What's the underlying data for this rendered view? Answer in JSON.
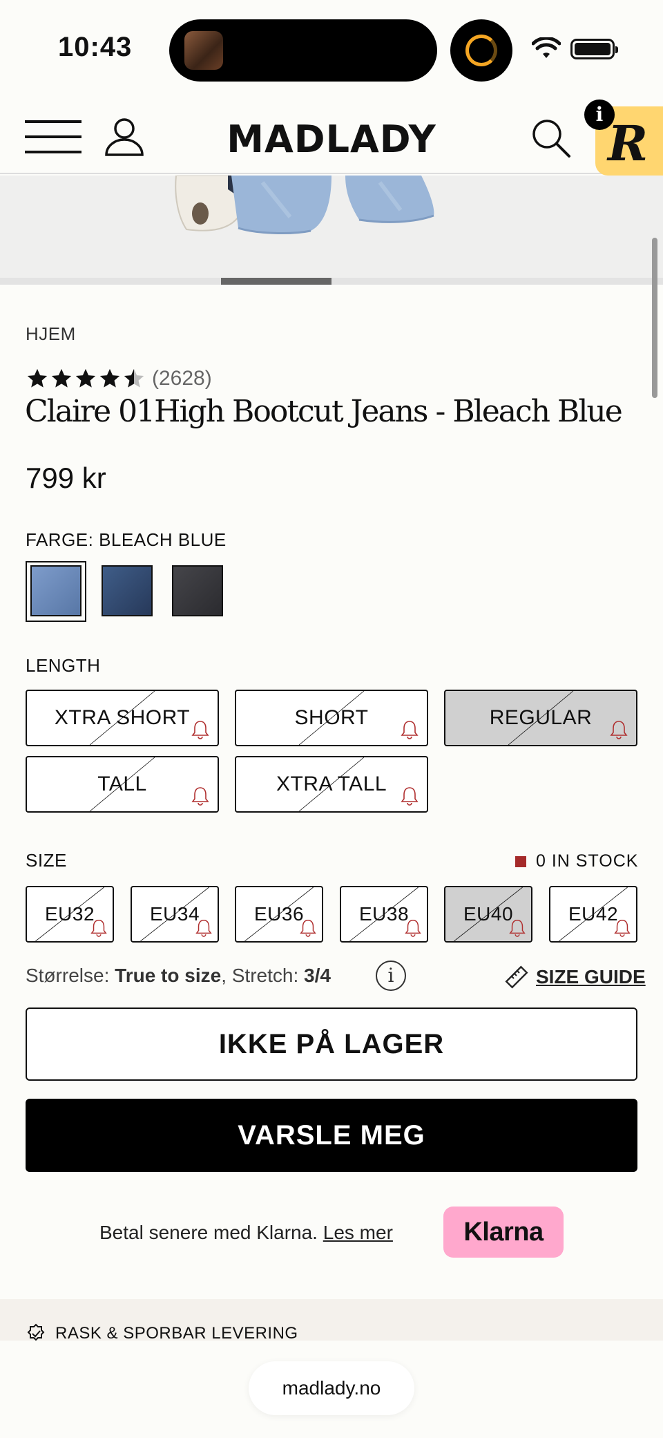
{
  "status_bar": {
    "time": "10:43"
  },
  "header": {
    "logo": "MADLADY"
  },
  "breadcrumb": "HJEM",
  "product": {
    "rating": 4.5,
    "rating_count": "(2628)",
    "title": "Claire 01High Bootcut Jeans - Bleach Blue",
    "price": "799 kr"
  },
  "color": {
    "label": "FARGE: BLEACH BLUE",
    "swatches": [
      {
        "name": "Bleach Blue",
        "color": "#6a8bb8",
        "selected": true
      },
      {
        "name": "Dark Blue",
        "color": "#34507a",
        "selected": false
      },
      {
        "name": "Black",
        "color": "#3a3a3e",
        "selected": false
      }
    ]
  },
  "length": {
    "label": "LENGTH",
    "options": [
      {
        "label": "XTRA SHORT",
        "selected": false
      },
      {
        "label": "SHORT",
        "selected": false
      },
      {
        "label": "REGULAR",
        "selected": true
      },
      {
        "label": "TALL",
        "selected": false
      },
      {
        "label": "XTRA TALL",
        "selected": false
      }
    ]
  },
  "size": {
    "label": "SIZE",
    "stock": "0 IN STOCK",
    "stock_color": "#a52a2a",
    "options": [
      {
        "label": "EU32",
        "selected": false
      },
      {
        "label": "EU34",
        "selected": false
      },
      {
        "label": "EU36",
        "selected": false
      },
      {
        "label": "EU38",
        "selected": false
      },
      {
        "label": "EU40",
        "selected": true
      },
      {
        "label": "EU42",
        "selected": false
      }
    ]
  },
  "fit": {
    "prefix": "Størrelse: ",
    "size_value": "True to size",
    "middle": ", Stretch: ",
    "stretch_value": "3/4"
  },
  "size_guide": "SIZE GUIDE",
  "buttons": {
    "out_of_stock": "IKKE PÅ LAGER",
    "notify": "VARSLE MEG"
  },
  "klarna": {
    "text": "Betal senere med Klarna. ",
    "link": "Les mer",
    "badge": "Klarna",
    "badge_color": "#ffa8cd"
  },
  "delivery": "RASK & SPORBAR LEVERING",
  "browser": {
    "url": "madlady.no"
  }
}
